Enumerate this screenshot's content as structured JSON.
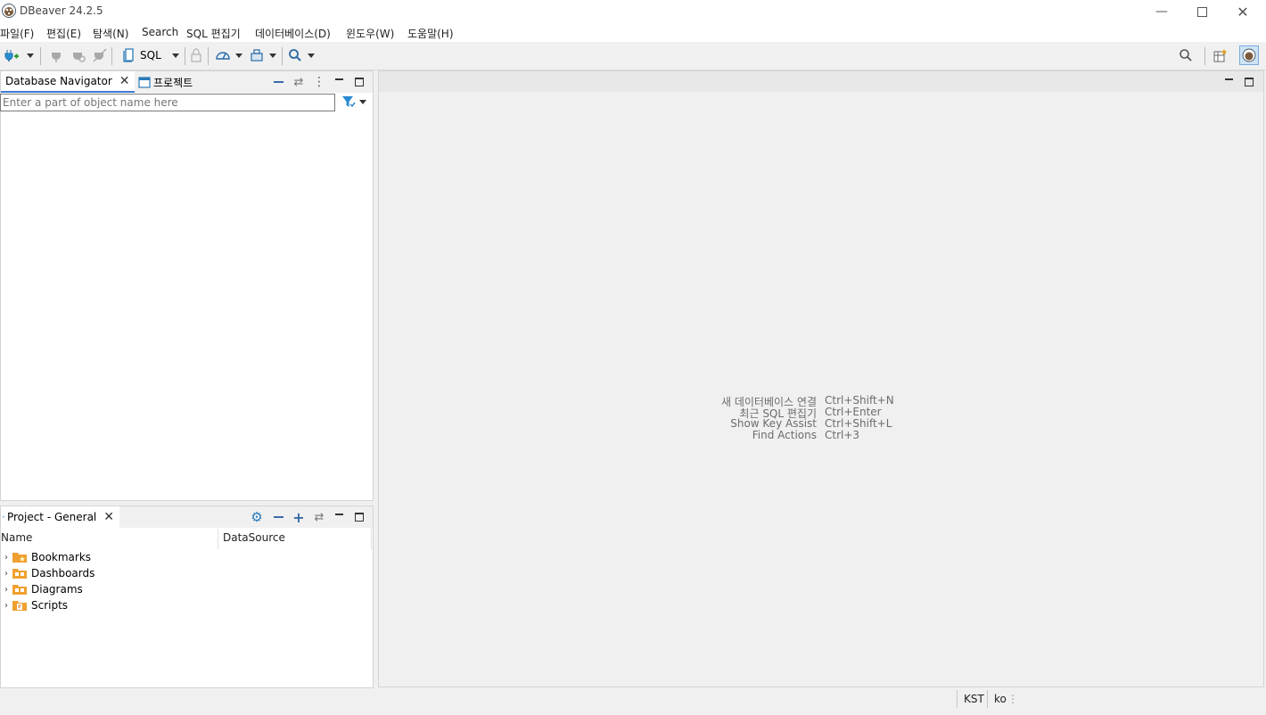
{
  "window": {
    "title": "DBeaver 24.2.5",
    "controls": [
      "minimize-icon",
      "maximize-icon",
      "close-icon"
    ]
  },
  "menu": {
    "items": [
      "파일(F)",
      "편집(E)",
      "탐색(N)",
      "Search",
      "SQL 편집기",
      "데이터베이스(D)",
      "윈도우(W)",
      "도움말(H)"
    ]
  },
  "toolbar": {
    "sql_label": "SQL"
  },
  "navigator": {
    "tab_active": "Database Navigator",
    "tab_other": "프로젝트",
    "filter_placeholder": "Enter a part of object name here"
  },
  "project": {
    "tab": "Project - General",
    "columns": [
      "Name",
      "DataSource"
    ],
    "items": [
      {
        "label": "Bookmarks",
        "icon": "bookmarks-folder-icon"
      },
      {
        "label": "Dashboards",
        "icon": "dashboards-folder-icon"
      },
      {
        "label": "Diagrams",
        "icon": "diagrams-folder-icon"
      },
      {
        "label": "Scripts",
        "icon": "scripts-folder-icon"
      }
    ]
  },
  "editor": {
    "hints": [
      {
        "label": "새 데이터베이스 연결",
        "shortcut": "Ctrl+Shift+N"
      },
      {
        "label": "최근 SQL 편집기",
        "shortcut": "Ctrl+Enter"
      },
      {
        "label": "Show Key Assist",
        "shortcut": "Ctrl+Shift+L"
      },
      {
        "label": "Find Actions",
        "shortcut": "Ctrl+3"
      }
    ]
  },
  "status": {
    "timezone": "KST",
    "locale": "ko"
  },
  "colors": {
    "accent": "#3c7ad6",
    "folder": "#f0a030"
  }
}
